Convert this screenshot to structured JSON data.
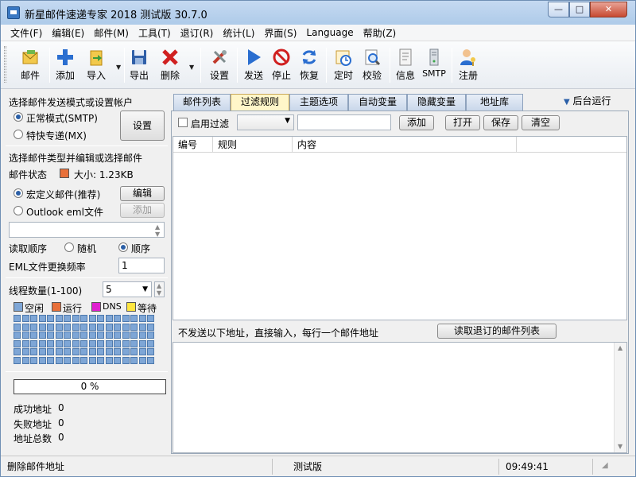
{
  "window": {
    "title": "新星邮件速递专家 2018 测试版 30.7.0",
    "controls": {
      "minimize": "—",
      "maximize": "□",
      "close": "✕"
    }
  },
  "menu": [
    "文件(F)",
    "编辑(E)",
    "邮件(M)",
    "工具(T)",
    "退订(R)",
    "统计(L)",
    "界面(S)",
    "Language",
    "帮助(Z)"
  ],
  "toolbar": {
    "mail": "邮件",
    "add": "添加",
    "import": "导入",
    "export": "导出",
    "delete": "删除",
    "settings": "设置",
    "send": "发送",
    "stop": "停止",
    "resume": "恢复",
    "schedule": "定时",
    "verify": "校验",
    "info": "信息",
    "smtp": "SMTP",
    "register": "注册"
  },
  "left": {
    "mode_heading": "选择邮件发送模式或设置帐户",
    "mode_normal": "正常模式(SMTP)",
    "mode_express": "特快专递(MX)",
    "settings_button": "设置",
    "mail_type_heading": "选择邮件类型并编辑或选择邮件",
    "mail_status_label": "邮件状态",
    "size_label": "大小: 1.23KB",
    "macro_mail": "宏定义邮件(推荐)",
    "edit_button": "编辑",
    "outlook_eml": "Outlook eml文件",
    "add_button": "添加",
    "file_path_value": "",
    "read_order_label": "读取顺序",
    "order_random": "随机",
    "order_sequential": "顺序",
    "eml_freq_label": "EML文件更换频率",
    "eml_freq_value": "1",
    "threads_label": "线程数量(1-100)",
    "threads_value": "5",
    "legend": {
      "idle": "空闲",
      "running": "运行",
      "dns": "DNS",
      "waiting": "等待"
    },
    "progress_text": "0 %",
    "progress": 0,
    "success_label": "成功地址",
    "success_value": "0",
    "failed_label": "失败地址",
    "failed_value": "0",
    "total_label": "地址总数",
    "total_value": "0"
  },
  "tabs": [
    "邮件列表",
    "过滤规则",
    "主题选项",
    "自动变量",
    "隐藏变量",
    "地址库"
  ],
  "active_tab": "过滤规则",
  "background_run": "后台运行",
  "filter": {
    "enable_label": "启用过滤",
    "select_value": "",
    "input_value": "",
    "add_button": "添加",
    "open_button": "打开",
    "save_button": "保存",
    "clear_button": "清空",
    "columns": [
      "编号",
      "规则",
      "内容"
    ],
    "no_send_label": "不发送以下地址，直接输入，每行一个邮件地址",
    "read_unsub_button": "读取退订的邮件列表"
  },
  "status": {
    "left": "删除邮件地址",
    "middle": "测试版",
    "time": "09:49:41"
  },
  "colors": {
    "idle": "#7ea6d6",
    "running": "#e8703a",
    "dns": "#e020d0",
    "waiting": "#ffe640",
    "mail_status": "#e8703a"
  }
}
